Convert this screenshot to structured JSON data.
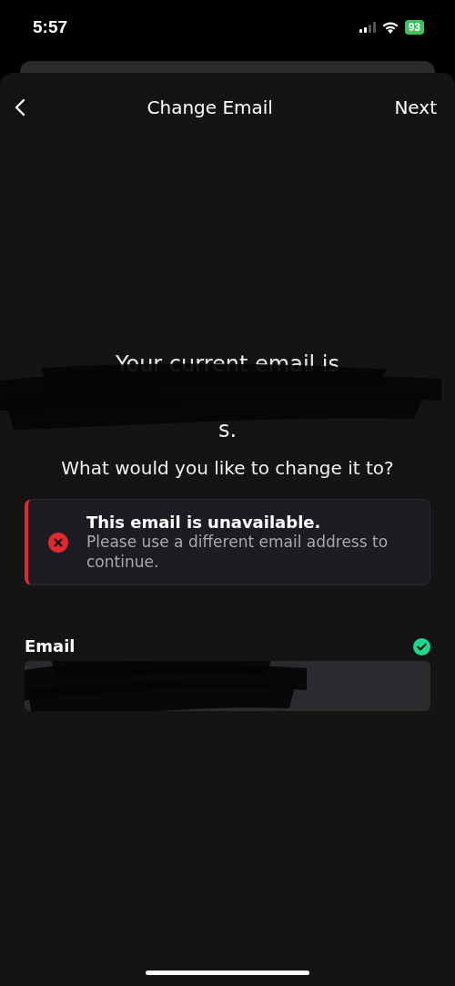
{
  "status_bar": {
    "time": "5:57",
    "battery": "93"
  },
  "nav": {
    "title": "Change Email",
    "action": "Next"
  },
  "message": {
    "lines": [
      "Your current email is",
      "s."
    ],
    "redacted": true
  },
  "question": "What would you like to change it to?",
  "alert": {
    "kind": "error",
    "title": "This email is unavailable.",
    "body": "Please use a different email address to continue."
  },
  "email_field": {
    "label": "Email",
    "valid": true,
    "redacted": true
  }
}
